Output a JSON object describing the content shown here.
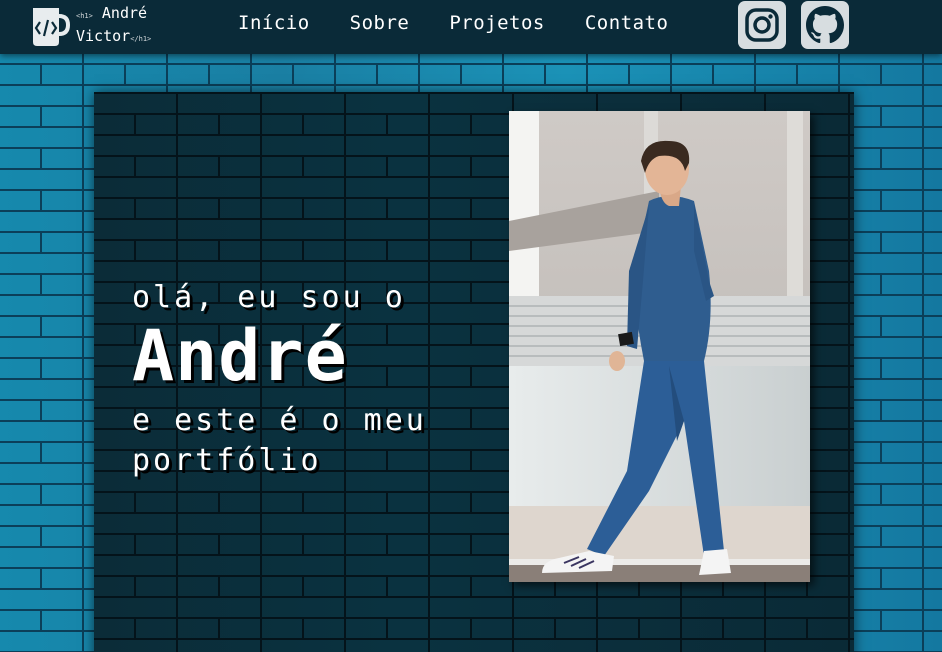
{
  "brand": {
    "line1": "André",
    "line2": "Victor",
    "open_tag": "<h1>",
    "close_tag": "</h1>"
  },
  "nav": [
    {
      "label": "Início"
    },
    {
      "label": "Sobre"
    },
    {
      "label": "Projetos"
    },
    {
      "label": "Contato"
    }
  ],
  "social": [
    {
      "icon": "instagram-icon"
    },
    {
      "icon": "github-icon"
    }
  ],
  "hero": {
    "greeting": "olá, eu sou o",
    "name": "André",
    "subtitle": "e este é o meu portfólio"
  },
  "colors": {
    "header_bg": "#0a2a38",
    "brick_blue": "#1a86a8",
    "panel_bg": "#0a2e3b",
    "social_bg": "#d7dde0"
  }
}
